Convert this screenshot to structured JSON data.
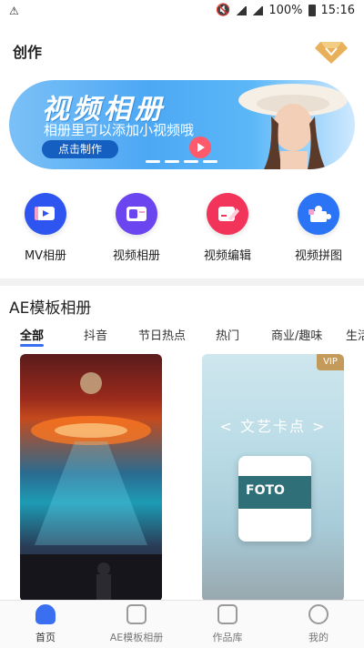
{
  "status": {
    "warning": "⚠",
    "battery": "100%",
    "time": "15:16"
  },
  "header": {
    "title": "创作"
  },
  "banner": {
    "title": "视频相册",
    "subtitle": "相册里可以添加小视频哦",
    "button": "点击制作"
  },
  "actions": [
    {
      "label": "MV相册",
      "color": "#2f55f0"
    },
    {
      "label": "视频相册",
      "color": "#6a45f0"
    },
    {
      "label": "视频编辑",
      "color": "#f2345a"
    },
    {
      "label": "视频拼图",
      "color": "#2b74f6"
    }
  ],
  "section": {
    "title": "AE模板相册"
  },
  "tabs": [
    {
      "label": "全部"
    },
    {
      "label": "抖音"
    },
    {
      "label": "节日热点"
    },
    {
      "label": "热门"
    },
    {
      "label": "商业/趣味"
    },
    {
      "label": "生活"
    }
  ],
  "cards": [
    {
      "vip": ""
    },
    {
      "vip": "VIP",
      "text": "< 文艺卡点 >",
      "film_label": "FOTO"
    }
  ],
  "nav": [
    {
      "label": "首页"
    },
    {
      "label": "AE模板相册"
    },
    {
      "label": "作品库"
    },
    {
      "label": "我的"
    }
  ]
}
